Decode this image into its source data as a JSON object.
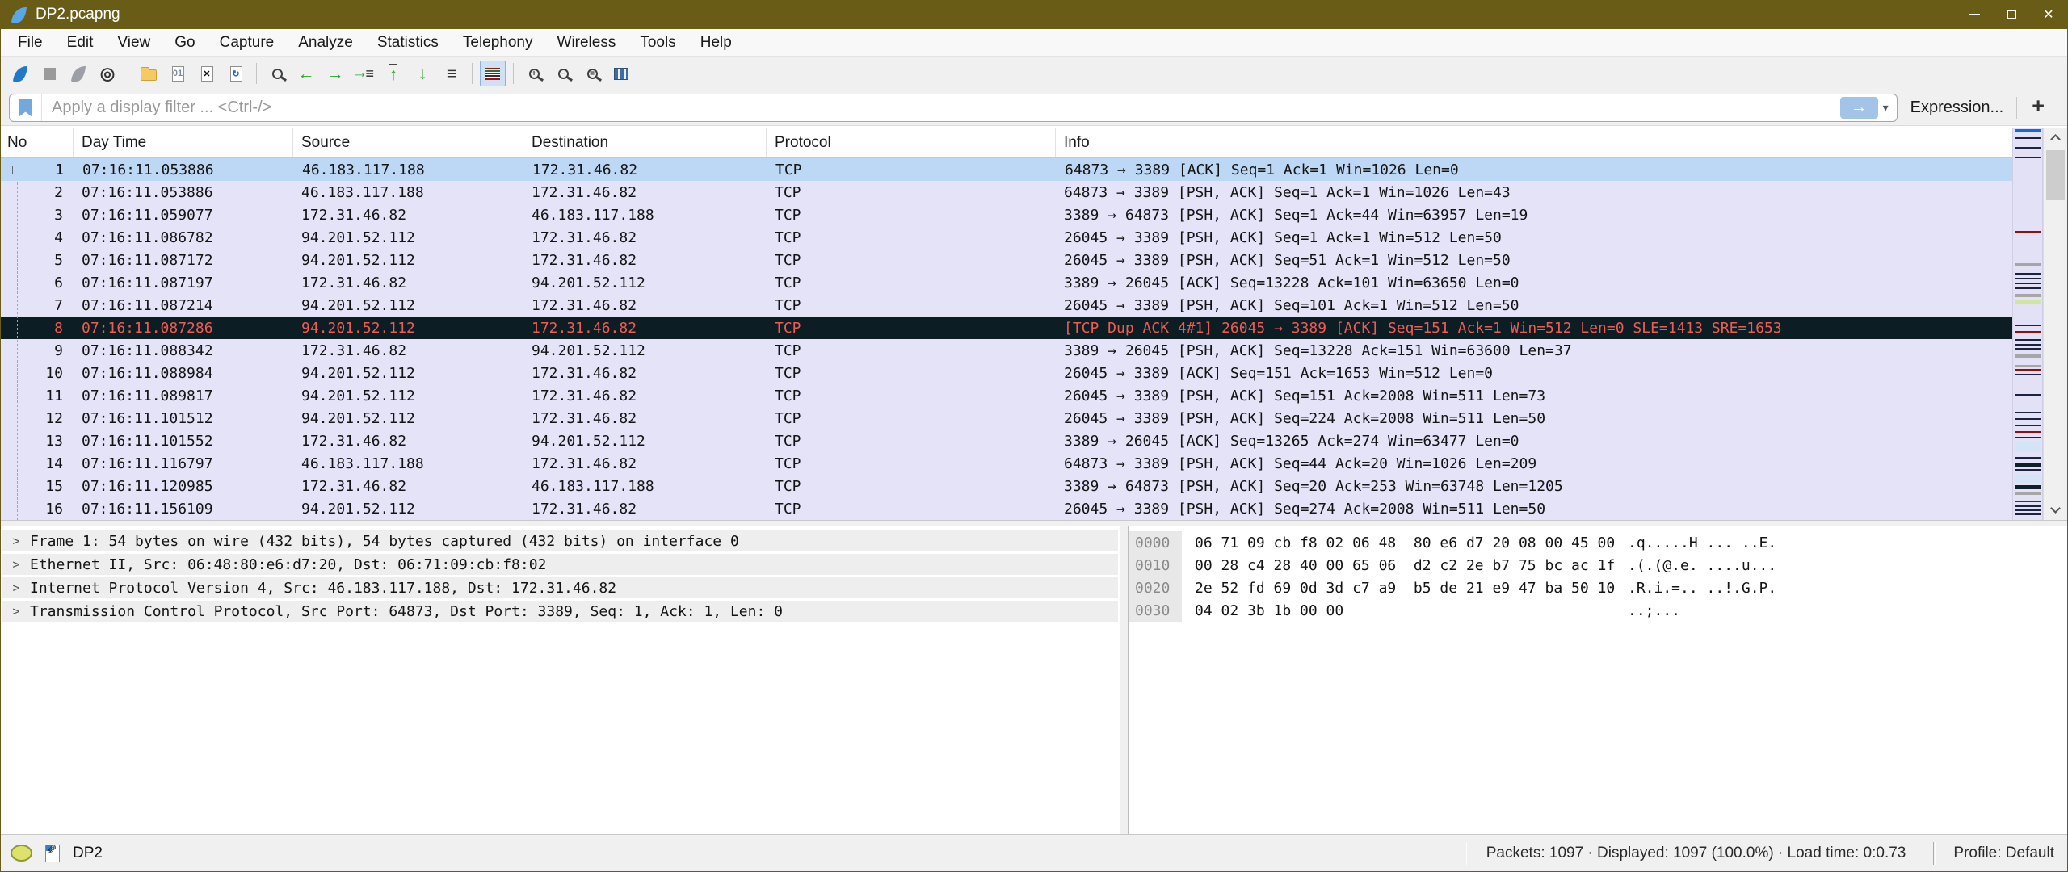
{
  "window": {
    "title": "DP2.pcapng",
    "controls": [
      {
        "name": "minimize-icon"
      },
      {
        "name": "maximize-icon"
      },
      {
        "name": "close-icon",
        "glyph": "✕"
      }
    ]
  },
  "menu": {
    "items": [
      {
        "label": "File"
      },
      {
        "label": "Edit"
      },
      {
        "label": "View"
      },
      {
        "label": "Go"
      },
      {
        "label": "Capture"
      },
      {
        "label": "Analyze"
      },
      {
        "label": "Statistics"
      },
      {
        "label": "Telephony"
      },
      {
        "label": "Wireless"
      },
      {
        "label": "Tools"
      },
      {
        "label": "Help"
      }
    ]
  },
  "toolbar": {
    "items": [
      {
        "name": "start-capture-icon",
        "kind": "fin",
        "color": "#2277c8"
      },
      {
        "name": "stop-capture-icon",
        "kind": "square"
      },
      {
        "name": "restart-capture-icon",
        "kind": "fin",
        "color": "#9aa0a6"
      },
      {
        "name": "capture-options-icon",
        "kind": "glyph",
        "glyph": "◎",
        "color": "#333333"
      },
      {
        "kind": "sep"
      },
      {
        "name": "open-file-icon",
        "kind": "folder"
      },
      {
        "name": "save-file-icon",
        "kind": "file",
        "glyph": "01",
        "glyphColor": "#7a8aa0"
      },
      {
        "name": "close-file-icon",
        "kind": "file",
        "glyph": "✕",
        "glyphColor": "#111111"
      },
      {
        "name": "reload-file-icon",
        "kind": "file",
        "glyph": "↻",
        "glyphColor": "#1a66c0"
      },
      {
        "kind": "sep"
      },
      {
        "name": "find-packet-icon",
        "kind": "mag",
        "glyph": ""
      },
      {
        "name": "go-back-icon",
        "kind": "glyph",
        "glyph": "←",
        "color": "#2fa32f"
      },
      {
        "name": "go-forward-icon",
        "kind": "glyph",
        "glyph": "→",
        "color": "#2fa32f"
      },
      {
        "name": "go-to-packet-icon",
        "kind": "goto"
      },
      {
        "name": "go-first-packet-icon",
        "kind": "glyph",
        "glyph": "↑",
        "color": "#2fa32f",
        "bar": true
      },
      {
        "name": "go-last-packet-icon",
        "kind": "glyph",
        "glyph": "↓",
        "color": "#2fa32f"
      },
      {
        "name": "auto-scroll-icon",
        "kind": "glyph",
        "glyph": "≡",
        "color": "#333333"
      },
      {
        "kind": "sep"
      },
      {
        "name": "colorize-packets-icon",
        "kind": "colorize",
        "active": true
      },
      {
        "kind": "sep"
      },
      {
        "name": "zoom-in-icon",
        "kind": "mag",
        "glyph": "+"
      },
      {
        "name": "zoom-out-icon",
        "kind": "mag",
        "glyph": "−"
      },
      {
        "name": "zoom-reset-icon",
        "kind": "mag",
        "glyph": "="
      },
      {
        "name": "resize-columns-icon",
        "kind": "table"
      }
    ]
  },
  "filter": {
    "placeholder": "Apply a display filter ... <Ctrl-/>",
    "apply_glyph": "→",
    "chevron_glyph": "▾",
    "expression_label": "Expression...",
    "add_label": "+"
  },
  "packet_list": {
    "columns": [
      "No",
      "Day Time",
      "Source",
      "Destination",
      "Protocol",
      "Info"
    ],
    "rows": [
      {
        "no": "1",
        "time": "07:16:11.053886",
        "src": "46.183.117.188",
        "dst": "172.31.46.82",
        "proto": "TCP",
        "info": "64873 → 3389 [ACK] Seq=1 Ack=1 Win=1026 Len=0",
        "state": "selected"
      },
      {
        "no": "2",
        "time": "07:16:11.053886",
        "src": "46.183.117.188",
        "dst": "172.31.46.82",
        "proto": "TCP",
        "info": "64873 → 3389 [PSH, ACK] Seq=1 Ack=1 Win=1026 Len=43",
        "state": ""
      },
      {
        "no": "3",
        "time": "07:16:11.059077",
        "src": "172.31.46.82",
        "dst": "46.183.117.188",
        "proto": "TCP",
        "info": "3389 → 64873 [PSH, ACK] Seq=1 Ack=44 Win=63957 Len=19",
        "state": ""
      },
      {
        "no": "4",
        "time": "07:16:11.086782",
        "src": "94.201.52.112",
        "dst": "172.31.46.82",
        "proto": "TCP",
        "info": "26045 → 3389 [PSH, ACK] Seq=1 Ack=1 Win=512 Len=50",
        "state": ""
      },
      {
        "no": "5",
        "time": "07:16:11.087172",
        "src": "94.201.52.112",
        "dst": "172.31.46.82",
        "proto": "TCP",
        "info": "26045 → 3389 [PSH, ACK] Seq=51 Ack=1 Win=512 Len=50",
        "state": ""
      },
      {
        "no": "6",
        "time": "07:16:11.087197",
        "src": "172.31.46.82",
        "dst": "94.201.52.112",
        "proto": "TCP",
        "info": "3389 → 26045 [ACK] Seq=13228 Ack=101 Win=63650 Len=0",
        "state": ""
      },
      {
        "no": "7",
        "time": "07:16:11.087214",
        "src": "94.201.52.112",
        "dst": "172.31.46.82",
        "proto": "TCP",
        "info": "26045 → 3389 [PSH, ACK] Seq=101 Ack=1 Win=512 Len=50",
        "state": ""
      },
      {
        "no": "8",
        "time": "07:16:11.087286",
        "src": "94.201.52.112",
        "dst": "172.31.46.82",
        "proto": "TCP",
        "info": "[TCP Dup ACK 4#1] 26045 → 3389 [ACK] Seq=151 Ack=1 Win=512 Len=0 SLE=1413 SRE=1653",
        "state": "bad"
      },
      {
        "no": "9",
        "time": "07:16:11.088342",
        "src": "172.31.46.82",
        "dst": "94.201.52.112",
        "proto": "TCP",
        "info": "3389 → 26045 [PSH, ACK] Seq=13228 Ack=151 Win=63600 Len=37",
        "state": ""
      },
      {
        "no": "10",
        "time": "07:16:11.088984",
        "src": "94.201.52.112",
        "dst": "172.31.46.82",
        "proto": "TCP",
        "info": "26045 → 3389 [ACK] Seq=151 Ack=1653 Win=512 Len=0",
        "state": ""
      },
      {
        "no": "11",
        "time": "07:16:11.089817",
        "src": "94.201.52.112",
        "dst": "172.31.46.82",
        "proto": "TCP",
        "info": "26045 → 3389 [PSH, ACK] Seq=151 Ack=2008 Win=511 Len=73",
        "state": ""
      },
      {
        "no": "12",
        "time": "07:16:11.101512",
        "src": "94.201.52.112",
        "dst": "172.31.46.82",
        "proto": "TCP",
        "info": "26045 → 3389 [PSH, ACK] Seq=224 Ack=2008 Win=511 Len=50",
        "state": ""
      },
      {
        "no": "13",
        "time": "07:16:11.101552",
        "src": "172.31.46.82",
        "dst": "94.201.52.112",
        "proto": "TCP",
        "info": "3389 → 26045 [ACK] Seq=13265 Ack=274 Win=63477 Len=0",
        "state": ""
      },
      {
        "no": "14",
        "time": "07:16:11.116797",
        "src": "46.183.117.188",
        "dst": "172.31.46.82",
        "proto": "TCP",
        "info": "64873 → 3389 [PSH, ACK] Seq=44 Ack=20 Win=1026 Len=209",
        "state": ""
      },
      {
        "no": "15",
        "time": "07:16:11.120985",
        "src": "172.31.46.82",
        "dst": "46.183.117.188",
        "proto": "TCP",
        "info": "3389 → 64873 [PSH, ACK] Seq=20 Ack=253 Win=63748 Len=1205",
        "state": ""
      },
      {
        "no": "16",
        "time": "07:16:11.156109",
        "src": "94.201.52.112",
        "dst": "172.31.46.82",
        "proto": "TCP",
        "info": "26045 → 3389 [PSH, ACK] Seq=274 Ack=2008 Win=511 Len=50",
        "state": ""
      }
    ]
  },
  "detail": {
    "lines": [
      "Frame 1: 54 bytes on wire (432 bits), 54 bytes captured (432 bits) on interface 0",
      "Ethernet II, Src: 06:48:80:e6:d7:20, Dst: 06:71:09:cb:f8:02",
      "Internet Protocol Version 4, Src: 46.183.117.188, Dst: 172.31.46.82",
      "Transmission Control Protocol, Src Port: 64873, Dst Port: 3389, Seq: 1, Ack: 1, Len: 0"
    ]
  },
  "hex": {
    "rows": [
      {
        "offset": "0000",
        "hex": "06 71 09 cb f8 02 06 48  80 e6 d7 20 08 00 45 00",
        "ascii": ".q.....H ... ..E."
      },
      {
        "offset": "0010",
        "hex": "00 28 c4 28 40 00 65 06  d2 c2 2e b7 75 bc ac 1f",
        "ascii": ".(.(@.e. ....u..."
      },
      {
        "offset": "0020",
        "hex": "2e 52 fd 69 0d 3d c7 a9  b5 de 21 e9 47 ba 50 10",
        "ascii": ".R.i.=.. ..!.G.P."
      },
      {
        "offset": "0030",
        "hex": "04 02 3b 1b 00 00",
        "ascii": "..;..."
      }
    ]
  },
  "status": {
    "file_label": "DP2",
    "stats": "Packets: 1097 · Displayed: 1097 (100.0%) ·  Load time: 0:0.73",
    "profile": "Profile: Default"
  },
  "minimap": {
    "colors": {
      "navy": "#1c2340",
      "red": "#8e1010",
      "gray": "#a6a6a6",
      "green": "#cfe6a2",
      "blue": "#1668d8",
      "ltblue": "#d4e4f6",
      "dark": "#10202a"
    },
    "marks": [
      {
        "t": 2,
        "c": "blue",
        "h": 4
      },
      {
        "t": 12,
        "c": "navy",
        "h": 2
      },
      {
        "t": 24,
        "c": "navy",
        "h": 2
      },
      {
        "t": 36,
        "c": "navy",
        "h": 2
      },
      {
        "t": 128,
        "c": "red",
        "h": 2
      },
      {
        "t": 168,
        "c": "gray",
        "h": 4
      },
      {
        "t": 180,
        "c": "navy",
        "h": 2
      },
      {
        "t": 186,
        "c": "navy",
        "h": 2
      },
      {
        "t": 192,
        "c": "navy",
        "h": 2
      },
      {
        "t": 198,
        "c": "navy",
        "h": 2
      },
      {
        "t": 206,
        "c": "gray",
        "h": 4
      },
      {
        "t": 213,
        "c": "green",
        "h": 5
      },
      {
        "t": 244,
        "c": "navy",
        "h": 2
      },
      {
        "t": 252,
        "c": "red",
        "h": 2
      },
      {
        "t": 262,
        "c": "navy",
        "h": 2
      },
      {
        "t": 268,
        "c": "navy",
        "h": 3
      },
      {
        "t": 273,
        "c": "navy",
        "h": 3
      },
      {
        "t": 281,
        "c": "gray",
        "h": 5
      },
      {
        "t": 294,
        "c": "gray",
        "h": 3
      },
      {
        "t": 299,
        "c": "red",
        "h": 2
      },
      {
        "t": 305,
        "c": "navy",
        "h": 2
      },
      {
        "t": 330,
        "c": "navy",
        "h": 2
      },
      {
        "t": 352,
        "c": "navy",
        "h": 2
      },
      {
        "t": 360,
        "c": "navy",
        "h": 2
      },
      {
        "t": 368,
        "c": "navy",
        "h": 2
      },
      {
        "t": 376,
        "c": "red",
        "h": 2
      },
      {
        "t": 383,
        "c": "navy",
        "h": 2
      },
      {
        "t": 390,
        "c": "ltblue",
        "h": 12
      },
      {
        "t": 408,
        "c": "navy",
        "h": 2
      },
      {
        "t": 415,
        "c": "dark",
        "h": 5
      },
      {
        "t": 423,
        "c": "navy",
        "h": 2
      },
      {
        "t": 430,
        "c": "ltblue",
        "h": 10
      },
      {
        "t": 443,
        "c": "dark",
        "h": 5
      },
      {
        "t": 451,
        "c": "gray",
        "h": 4
      },
      {
        "t": 462,
        "c": "red",
        "h": 2
      },
      {
        "t": 467,
        "c": "navy",
        "h": 3
      },
      {
        "t": 472,
        "c": "navy",
        "h": 3
      },
      {
        "t": 477,
        "c": "navy",
        "h": 3
      }
    ]
  }
}
